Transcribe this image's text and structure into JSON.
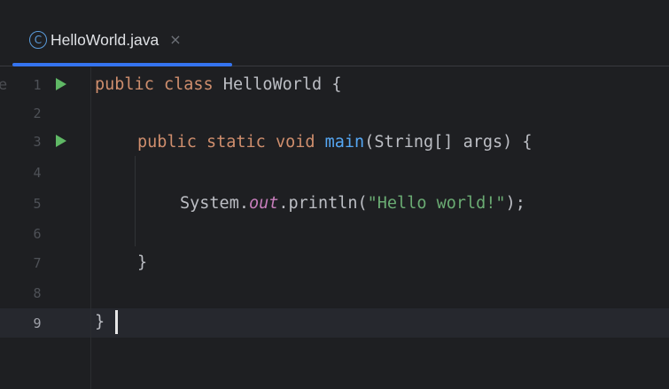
{
  "tab": {
    "icon_glyph": "C",
    "icon_name": "java-class-icon",
    "title": "HelloWorld.java",
    "close_glyph": "×",
    "accent_color": "#3574f0"
  },
  "editor": {
    "edge_glyph": "e",
    "current_line": "9",
    "line_numbers": [
      "1",
      "2",
      "3",
      "4",
      "5",
      "6",
      "7",
      "8",
      "9"
    ],
    "lines": {
      "l1": {
        "kw1": "public",
        "kw2": "class",
        "name": " HelloWorld {"
      },
      "l3": {
        "kw1": "public",
        "kw2": "static",
        "kw3": "void",
        "fn": "main",
        "rest": "(String[] args) {"
      },
      "l5": {
        "pre": "System.",
        "field": "out",
        "mid": ".println(",
        "str": "\"Hello world!\"",
        "end": ");"
      },
      "l7": {
        "text": "}"
      },
      "l9": {
        "text": "}"
      }
    },
    "run_icons": [
      "run-line-1",
      "run-line-3"
    ],
    "colors": {
      "keyword": "#cf8e6d",
      "function": "#56a8f5",
      "static_field": "#c77dbb",
      "string": "#6aab73",
      "run_icon": "#5fb865"
    }
  }
}
